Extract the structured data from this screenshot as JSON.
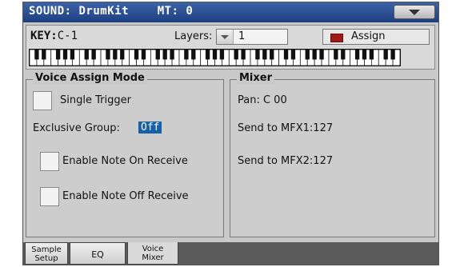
{
  "titlebar": {
    "title": "SOUND: DrumKit    MT: 0",
    "menu_icon": "chevron-down-icon"
  },
  "key": {
    "label": "KEY:",
    "value": "C-1",
    "layers_label": "Layers:",
    "layers_value": "1",
    "assign_label": "Assign",
    "assign_led_color": "#a11818"
  },
  "voice_assign": {
    "title": "Voice Assign Mode",
    "single_trigger": "Single Trigger",
    "exclusive_group_label": "Exclusive Group:",
    "exclusive_group_value": "Off",
    "note_on": "Enable Note On Receive",
    "note_off": "Enable Note Off Receive"
  },
  "mixer": {
    "title": "Mixer",
    "pan": "Pan: C 00",
    "send1": "Send to MFX1:127",
    "send2": "Send to MFX2:127"
  },
  "tabs": [
    {
      "line1": "Sample",
      "line2": "Setup"
    },
    {
      "line1": "EQ",
      "line2": ""
    },
    {
      "line1": "Voice",
      "line2": "Mixer"
    }
  ]
}
